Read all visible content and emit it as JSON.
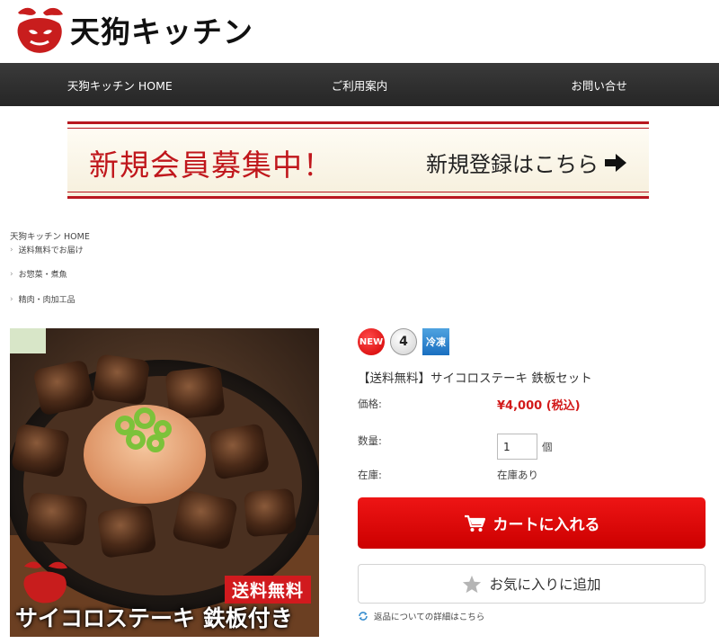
{
  "header": {
    "logo_text": "天狗キッチン"
  },
  "nav": {
    "items": [
      {
        "label": "天狗キッチン HOME"
      },
      {
        "label": "ご利用案内"
      },
      {
        "label": "お問い合せ"
      }
    ]
  },
  "banner": {
    "main": "新規会員募集中！",
    "cta": "新規登録はこちら"
  },
  "breadcrumb": {
    "home": "天狗キッチン HOME",
    "items": [
      {
        "label": "送料無料でお届け"
      },
      {
        "label": "お惣菜・煮魚"
      },
      {
        "label": "精肉・肉加工品"
      }
    ]
  },
  "product": {
    "image": {
      "badge": "送料無料",
      "caption": "サイコロステーキ 鉄板付き"
    },
    "badges": {
      "new": "NEW",
      "number": "4",
      "frozen": "冷凍"
    },
    "title": "【送料無料】サイコロステーキ 鉄板セット",
    "price_label": "価格:",
    "price": "¥4,000 (税込)",
    "qty_label": "数量:",
    "qty_value": "1",
    "qty_unit": "個",
    "stock_label": "在庫:",
    "stock_value": "在庫あり",
    "cart_button": "カートに入れる",
    "favorite_button": "お気に入りに追加",
    "return_link": "返品についての詳細はこちら"
  },
  "colors": {
    "accent_red": "#cc0000",
    "nav_bg": "#2e2e2e",
    "price_red": "#d21a1a"
  }
}
